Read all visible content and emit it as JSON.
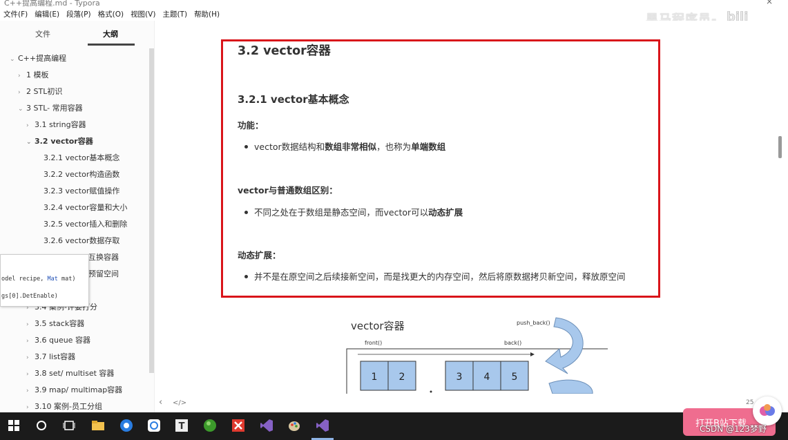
{
  "window": {
    "title": "C++提高编程.md - Typora",
    "close": "×"
  },
  "menu": [
    "文件(F)",
    "编辑(E)",
    "段落(P)",
    "格式(O)",
    "视图(V)",
    "主题(T)",
    "帮助(H)"
  ],
  "watermark": "黑马程序员-",
  "sidebar": {
    "tabs": [
      "文件",
      "大纲"
    ],
    "active_tab": "大纲",
    "items": [
      {
        "chev": "⌄",
        "label": "C++提高编程"
      },
      {
        "chev": "›",
        "label": "1 模板"
      },
      {
        "chev": "›",
        "label": "2 STL初识"
      },
      {
        "chev": "⌄",
        "label": "3 STL- 常用容器"
      },
      {
        "chev": "›",
        "label": "3.1 string容器"
      },
      {
        "chev": "⌄",
        "label": "3.2 vector容器"
      },
      {
        "chev": "",
        "label": "3.2.1 vector基本概念"
      },
      {
        "chev": "",
        "label": "3.2.2 vector构造函数"
      },
      {
        "chev": "",
        "label": "3.2.3 vector赋值操作"
      },
      {
        "chev": "",
        "label": "3.2.4 vector容量和大小"
      },
      {
        "chev": "",
        "label": "3.2.5 vector插入和删除"
      },
      {
        "chev": "",
        "label": "3.2.6 vector数据存取"
      },
      {
        "chev": "",
        "label": "互换容器"
      },
      {
        "chev": "",
        "label": "预留空间"
      },
      {
        "chev": "›",
        "label": "3.4 案例-评委打分"
      },
      {
        "chev": "›",
        "label": "3.5 stack容器"
      },
      {
        "chev": "›",
        "label": "3.6 queue 容器"
      },
      {
        "chev": "›",
        "label": "3.7 list容器"
      },
      {
        "chev": "›",
        "label": "3.8 set/ multiset 容器"
      },
      {
        "chev": "›",
        "label": "3.9 map/ multimap容器"
      },
      {
        "chev": "›",
        "label": "3.10 案例-员工分组"
      }
    ]
  },
  "popup": {
    "line1_pre": "odel recipe, ",
    "line1_kw": "Mat",
    "line1_post": " mat)",
    "line2": "gs[0].DetEnable)"
  },
  "doc": {
    "h2": "3.2 vector容器",
    "h3": "3.2.1 vector基本概念",
    "p1": "功能：",
    "b1_a": "vector数据结构和",
    "b1_b": "数组非常相似",
    "b1_c": "，也称为",
    "b1_d": "单端数组",
    "p2": "vector与普通数组区别：",
    "b2_a": "不同之处在于数组是静态空间，而vector可以",
    "b2_b": "动态扩展",
    "p3": "动态扩展：",
    "b3": "并不是在原空间之后续接新空间，而是找更大的内存空间，然后将原数据拷贝新空间，释放原空间"
  },
  "diagram": {
    "title": "vector容器",
    "push_back": "push_back()",
    "front": "front()",
    "back": "back()",
    "cells": [
      "1",
      "2",
      "3",
      "4",
      "5"
    ]
  },
  "footer": {
    "left": "‹",
    "code": "</>",
    "page": "25"
  },
  "bili": {
    "button": "打开B站下载",
    "csdn": "CSDN @123梦野"
  }
}
